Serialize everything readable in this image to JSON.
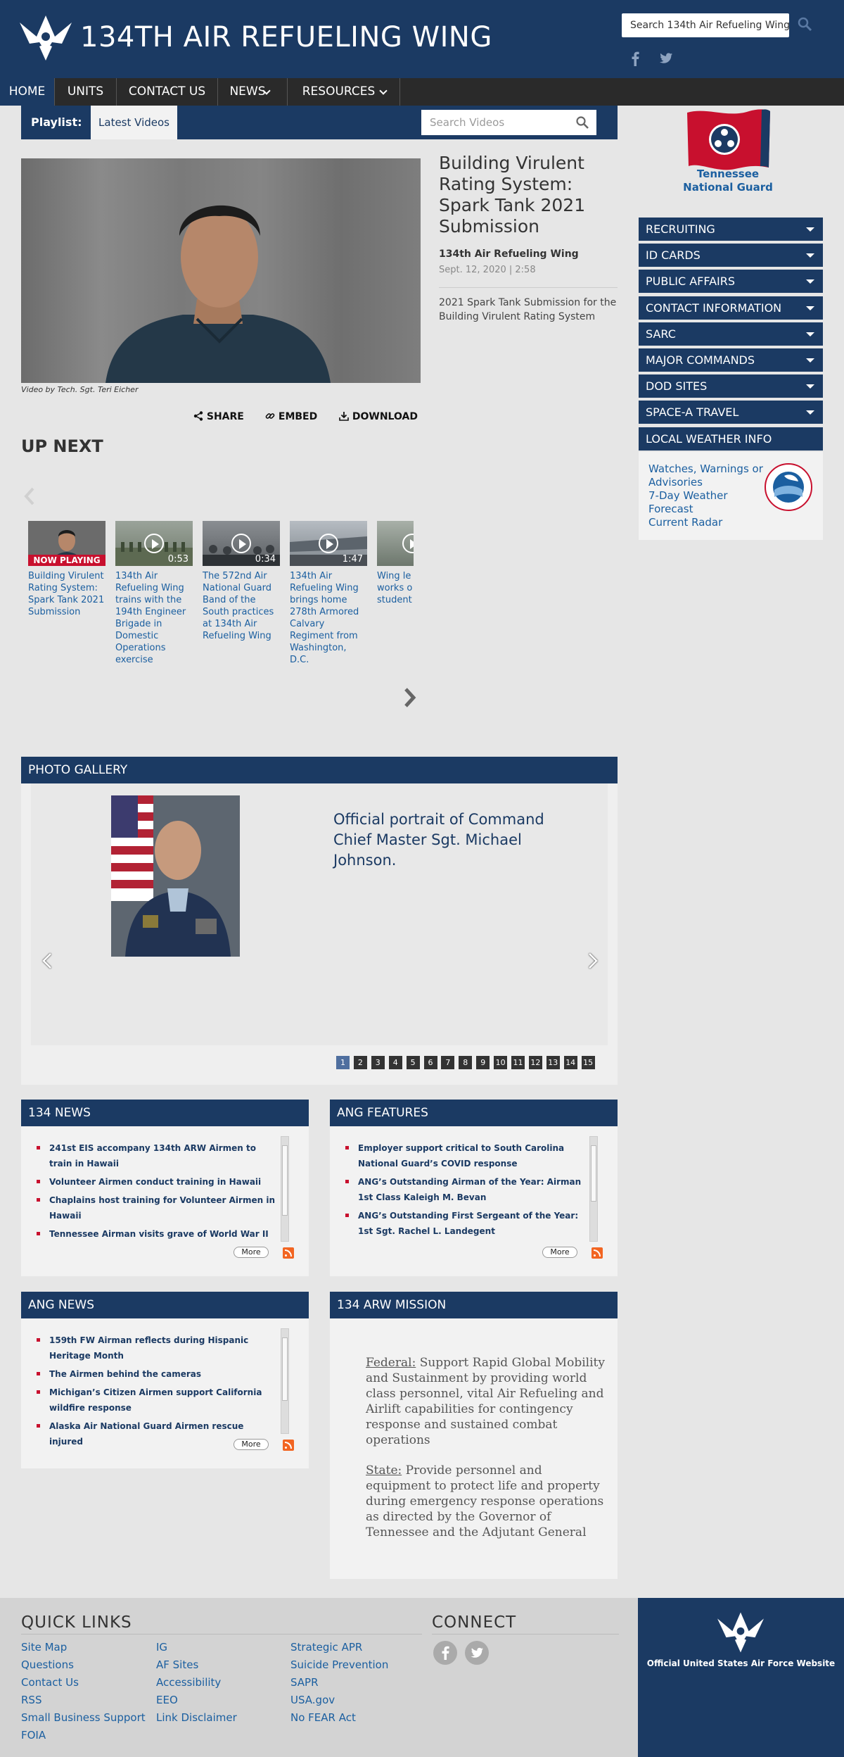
{
  "header": {
    "site_title": "134TH AIR REFUELING WING",
    "search_value": "Search 134th Air Refueling Wing"
  },
  "nav": {
    "items": [
      "HOME",
      "UNITS",
      "CONTACT US",
      "NEWS",
      "RESOURCES"
    ]
  },
  "playlist": {
    "label": "Playlist:",
    "tab": "Latest Videos",
    "search_placeholder": "Search Videos"
  },
  "video": {
    "title": "Building Virulent Rating System: Spark Tank 2021 Submission",
    "author": "134th Air Refueling Wing",
    "date": "Sept. 12, 2020 | 2:58",
    "description": "2021 Spark Tank Submission for the Building Virulent Rating System",
    "credit": "Video by Tech. Sgt. Teri Eicher",
    "actions": {
      "share": "SHARE",
      "embed": "EMBED",
      "download": "DOWNLOAD"
    }
  },
  "up_next": {
    "title": "UP NEXT",
    "items": [
      {
        "caption": "Building Virulent Rating System: Spark Tank 2021 Submission",
        "badge": "NOW PLAYING",
        "duration": ""
      },
      {
        "caption": "134th Air Refueling Wing trains with the 194th Engineer Brigade in Domestic Operations exercise",
        "duration": "0:53"
      },
      {
        "caption": "The 572nd Air National Guard Band of the South practices at 134th Air Refueling Wing",
        "duration": "0:34"
      },
      {
        "caption": "134th Air Refueling Wing brings home 278th Armored Calvary Regiment from Washington, D.C.",
        "duration": "1:47"
      },
      {
        "caption": "Wing le works o student",
        "duration": ""
      }
    ]
  },
  "photo_gallery": {
    "title": "PHOTO GALLERY",
    "caption": "Official portrait of Command Chief Master Sgt. Michael Johnson.",
    "pages": [
      "1",
      "2",
      "3",
      "4",
      "5",
      "6",
      "7",
      "8",
      "9",
      "10",
      "11",
      "12",
      "13",
      "14",
      "15"
    ],
    "current_page": 1
  },
  "news_134": {
    "title": "134 NEWS",
    "items": [
      "241st EIS accompany 134th ARW Airmen to train in Hawaii",
      "Volunteer Airmen conduct training in Hawaii",
      "Chaplains host training for Volunteer Airmen in Hawaii",
      "Tennessee Airman visits grave of World War II"
    ],
    "more": "More"
  },
  "ang_features": {
    "title": "ANG FEATURES",
    "items": [
      "Employer support critical to South Carolina National Guard’s COVID response",
      "ANG’s Outstanding Airman of the Year: Airman 1st Class Kaleigh M. Bevan",
      "ANG’s Outstanding First Sergeant of the Year: 1st Sgt. Rachel L. Landegent"
    ],
    "more": "More"
  },
  "ang_news": {
    "title": "ANG NEWS",
    "items": [
      "159th FW Airman reflects during Hispanic Heritage Month",
      "The Airmen behind the cameras",
      "Michigan’s Citizen Airmen support California wildfire response",
      "Alaska Air National Guard Airmen rescue injured"
    ],
    "more": "More"
  },
  "mission": {
    "title": "134 ARW MISSION",
    "federal_label": "Federal:",
    "federal_text": " Support Rapid Global Mobility and Sustainment by providing world class personnel, vital Air Refueling and Airlift capabilities for contingency response and sustained combat operations",
    "state_label": "State:",
    "state_text": " Provide personnel and equipment to protect life and property during emergency response operations as directed by the Governor of Tennessee and the Adjutant General"
  },
  "sidebar": {
    "state_label": "Tennessee National Guard",
    "items": [
      "RECRUITING",
      "ID CARDS",
      "PUBLIC AFFAIRS",
      "CONTACT INFORMATION",
      "SARC",
      "MAJOR COMMANDS",
      "DOD SITES",
      "SPACE-A TRAVEL",
      "LOCAL WEATHER INFO"
    ],
    "weather_links": [
      "Watches, Warnings or Advisories",
      "7-Day Weather Forecast",
      "Current Radar"
    ]
  },
  "footer": {
    "quick_links_title": "QUICK LINKS",
    "connect_title": "CONNECT",
    "col1": [
      "Site Map",
      "Questions",
      "Contact Us",
      "RSS",
      "Small Business Support",
      "FOIA"
    ],
    "col2": [
      "IG",
      "AF Sites",
      "Accessibility",
      "EEO",
      "Link Disclaimer"
    ],
    "col3": [
      "Strategic APR",
      "Suicide Prevention",
      "SAPR",
      "USA.gov",
      "No FEAR Act"
    ],
    "af_text": "Official United States Air Force Website"
  },
  "colors": {
    "navy": "#1b3a63",
    "link": "#1b5fa0",
    "red": "#c8102e"
  }
}
